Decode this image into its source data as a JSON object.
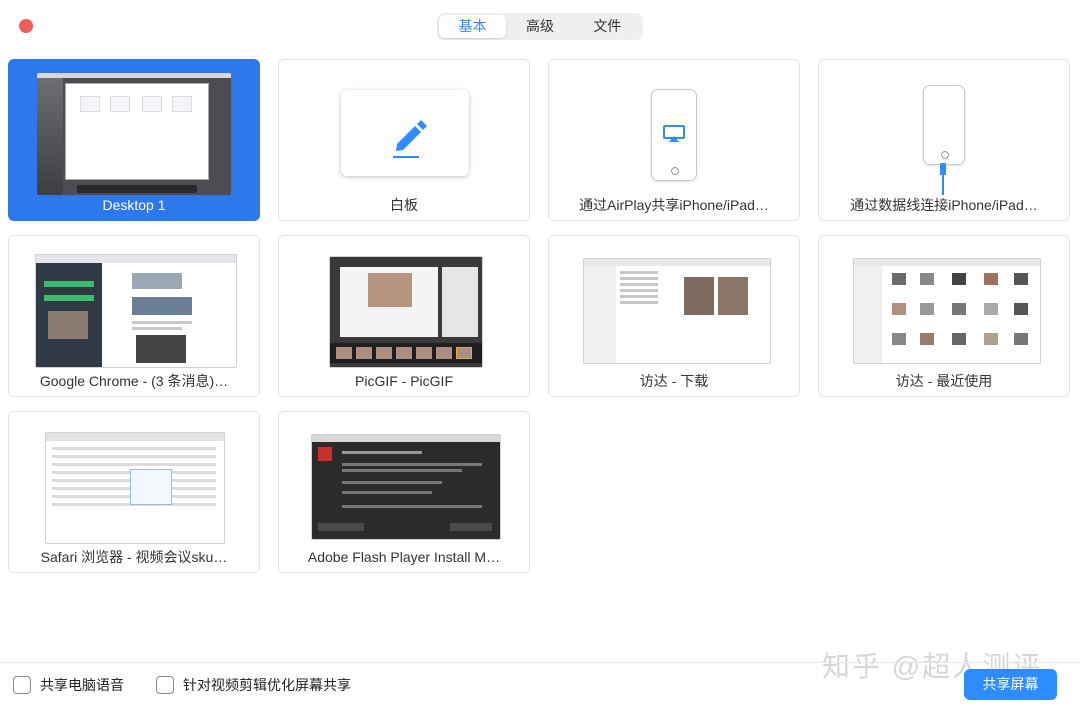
{
  "tabs": [
    {
      "label": "基本",
      "active": true
    },
    {
      "label": "高级",
      "active": false
    },
    {
      "label": "文件",
      "active": false
    }
  ],
  "cards": [
    {
      "label": "Desktop 1",
      "selected": true
    },
    {
      "label": "白板",
      "selected": false
    },
    {
      "label": "通过AirPlay共享iPhone/iPad…",
      "selected": false
    },
    {
      "label": "通过数据线连接iPhone/iPad…",
      "selected": false
    },
    {
      "label": "Google Chrome - (3 条消息)…",
      "selected": false
    },
    {
      "label": "PicGIF - PicGIF",
      "selected": false
    },
    {
      "label": "访达 - 下载",
      "selected": false
    },
    {
      "label": "访达 - 最近使用",
      "selected": false
    },
    {
      "label": "Safari 浏览器 - 视频会议sku…",
      "selected": false
    },
    {
      "label": "Adobe Flash Player Install M…",
      "selected": false
    }
  ],
  "options": {
    "share_audio": {
      "label": "共享电脑语音",
      "checked": false
    },
    "optimize_video": {
      "label": "针对视频剪辑优化屏幕共享",
      "checked": false
    }
  },
  "share_button": "共享屏幕",
  "watermark": "知乎 @超人测评",
  "colors": {
    "accent": "#2d8cff",
    "selected": "#2d79ec",
    "close": "#ee5d57"
  }
}
